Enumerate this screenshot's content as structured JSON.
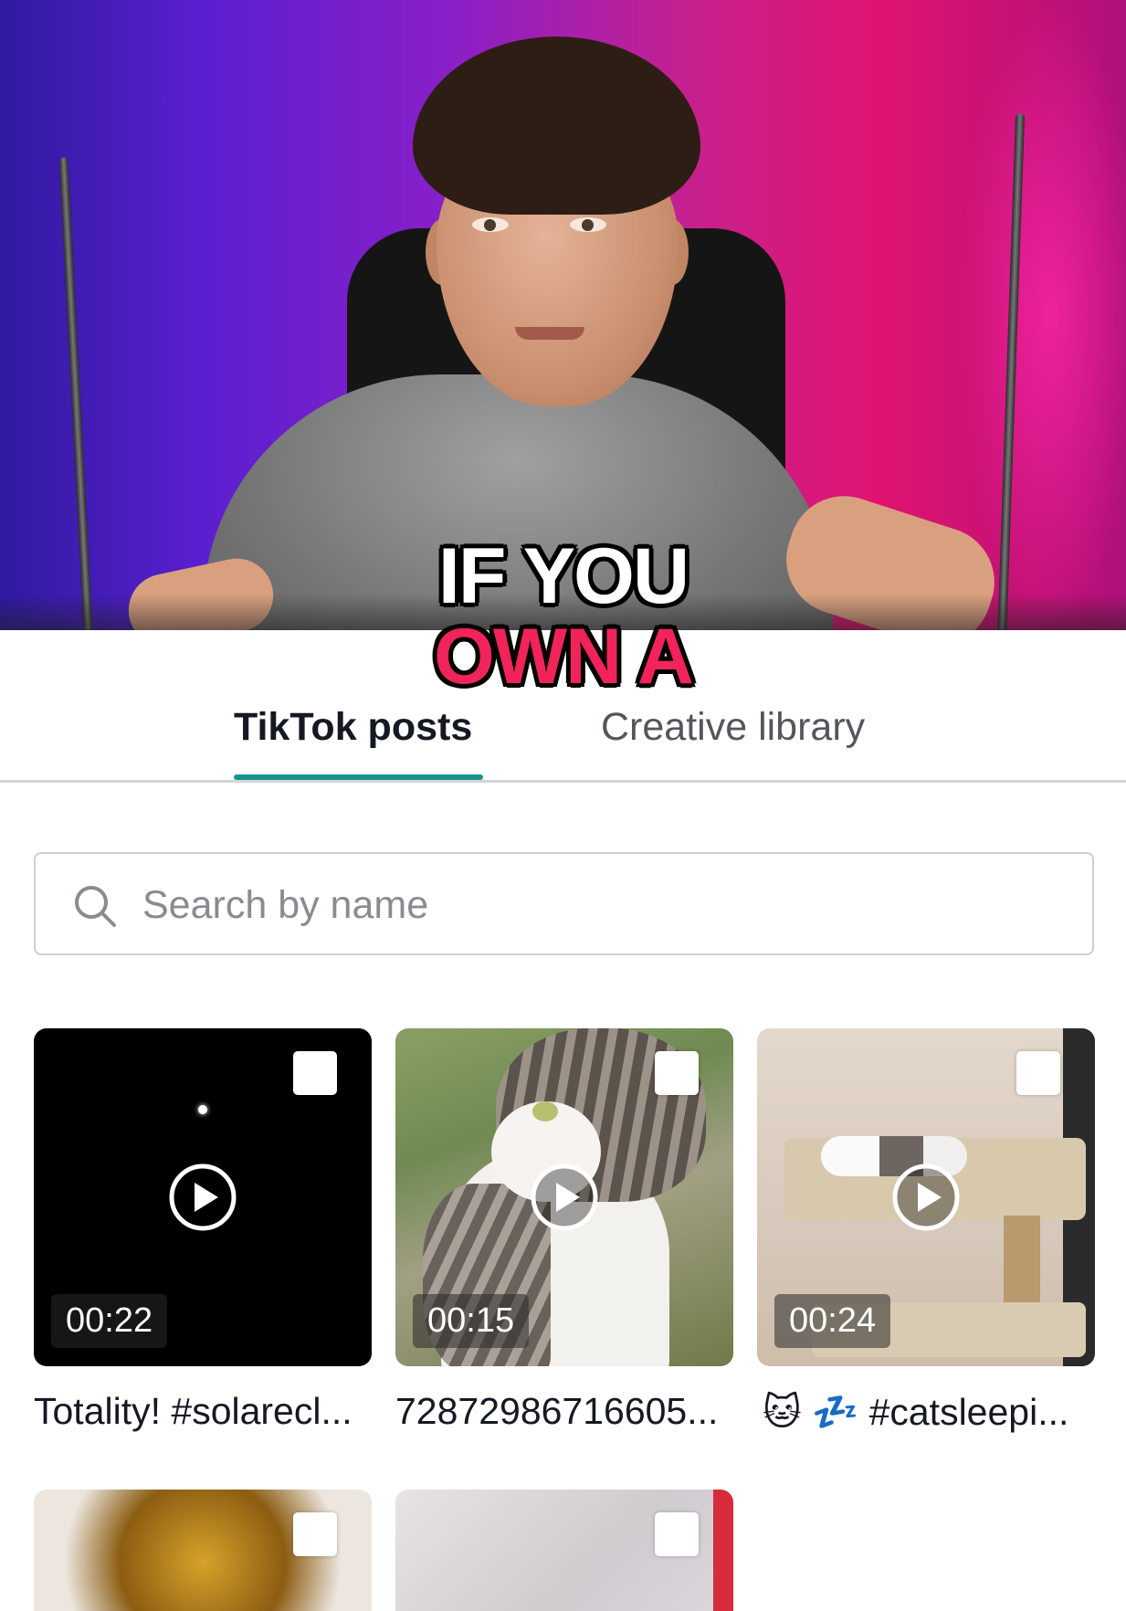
{
  "video": {
    "caption_line1": "IF YOU",
    "caption_line2": "OWN A"
  },
  "tabs": [
    {
      "label": "TikTok posts",
      "active": true
    },
    {
      "label": "Creative library",
      "active": false
    }
  ],
  "colors": {
    "accent": "#17948a",
    "caption_highlight": "#f0245a",
    "text_primary": "#161823"
  },
  "search": {
    "placeholder": "Search by name",
    "value": "",
    "icon": "search-icon"
  },
  "posts": [
    {
      "duration": "00:22",
      "title": "Totality! #solarecl...",
      "icon": "play-icon"
    },
    {
      "duration": "00:15",
      "title": "72872986716605...",
      "icon": "play-icon"
    },
    {
      "duration": "00:24",
      "title": "🐱 💤 #catsleepi...",
      "icon": "play-icon"
    },
    {
      "duration": "",
      "title": ""
    },
    {
      "duration": "",
      "title": ""
    }
  ]
}
